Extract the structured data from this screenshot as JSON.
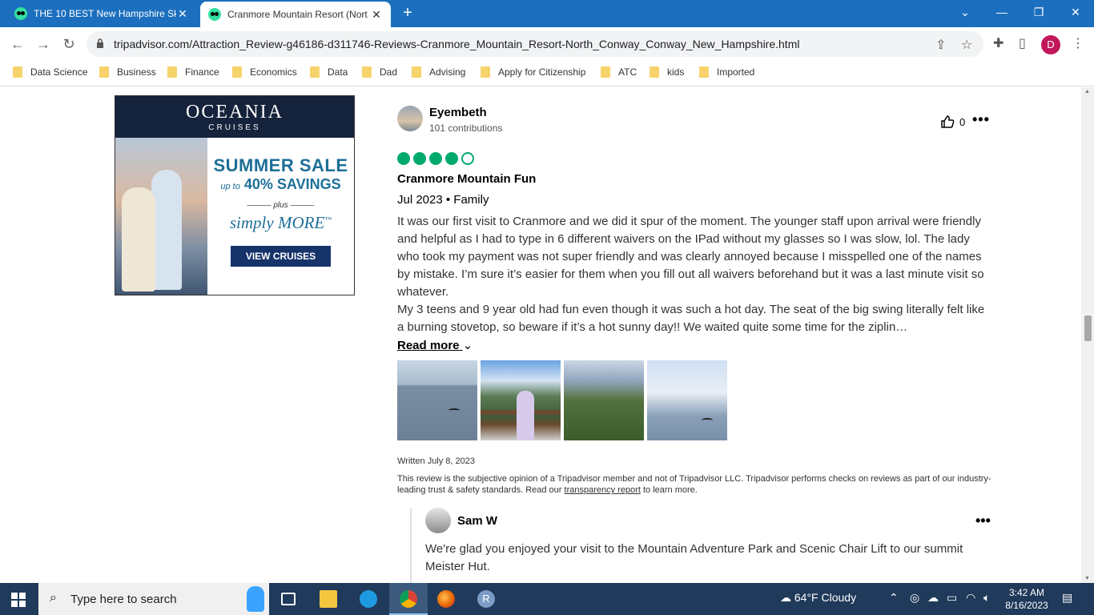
{
  "browser": {
    "tabs": [
      {
        "title": "THE 10 BEST New Hampshire Ski",
        "active": false
      },
      {
        "title": "Cranmore Mountain Resort (Nort",
        "active": true
      }
    ],
    "url": "tripadvisor.com/Attraction_Review-g46186-d311746-Reviews-Cranmore_Mountain_Resort-North_Conway_Conway_New_Hampshire.html",
    "profile_initial": "D",
    "bookmarks": [
      "Data Science",
      "Business",
      "Finance",
      "Economics",
      "Data",
      "Dad",
      "Advising",
      "Apply for Citizenship",
      "ATC",
      "kids",
      "Imported"
    ]
  },
  "ad": {
    "brand": "OCEANIA",
    "brand_sub": "CRUISES",
    "headline": "SUMMER SALE",
    "savings_prefix": "up to",
    "savings": "40% SAVINGS",
    "plus": "plus",
    "more": "simply MORE",
    "tm": "™",
    "cta": "VIEW CRUISES"
  },
  "review": {
    "author": "Eyembeth",
    "contributions": "101 contributions",
    "likes": "0",
    "rating": 4,
    "rating_max": 5,
    "title": "Cranmore Mountain Fun",
    "date_trip": "Jul 2023 • Family",
    "body_p1": "It was our first visit to Cranmore and we did it spur of the moment. The younger staff upon arrival were friendly and helpful as I had to type in 6 different waivers on the IPad without my glasses so I was slow, lol. The lady who took my payment was not super friendly and was clearly annoyed because I misspelled one of the names by mistake. I’m sure it’s easier for them when you fill out all waivers beforehand but it was a last minute visit so whatever.",
    "body_p2": "My 3 teens and 9 year old had fun even though it was such a hot day. The seat of the big swing literally felt like a burning stovetop, so beware if it’s a hot sunny day!! We waited quite some time for the ziplin…",
    "read_more": "Read more",
    "written": "Written July 8, 2023",
    "disclaimer_a": "This review is the subjective opinion of a Tripadvisor member and not of Tripadvisor LLC. Tripadvisor performs checks on reviews as part of our industry-leading trust & safety standards. Read our ",
    "disclaimer_link": "transparency report",
    "disclaimer_b": " to learn more."
  },
  "response": {
    "author": "Sam W",
    "body": "We're glad you enjoyed your visit to the Mountain Adventure Park and Scenic Chair Lift to our summit Meister Hut."
  },
  "taskbar": {
    "search_placeholder": "Type here to search",
    "weather": "64°F  Cloudy",
    "time": "3:42 AM",
    "date": "8/16/2023",
    "browser_app_letter": "R"
  }
}
